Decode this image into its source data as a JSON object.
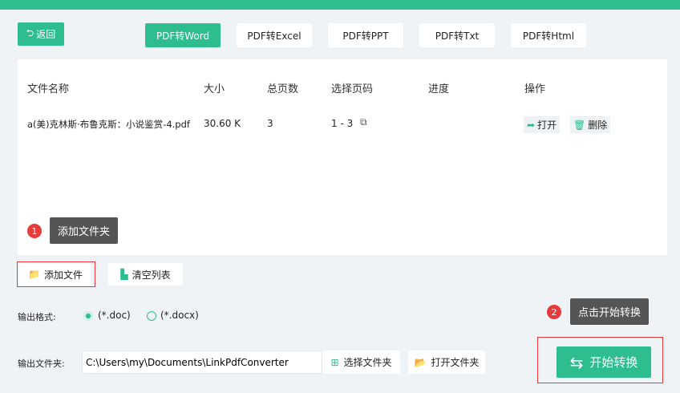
{
  "toolbar": {
    "back": "返回",
    "tabs": [
      "PDF转Word",
      "PDF转Excel",
      "PDF转PPT",
      "PDF转Txt",
      "PDF转Html"
    ]
  },
  "table": {
    "headers": [
      "文件名称",
      "大小",
      "总页数",
      "选择页码",
      "进度",
      "操作"
    ],
    "rows": [
      {
        "name": "a(美)克林斯·布鲁克斯：小说鉴赏-4.pdf",
        "size": "30.60 K",
        "pages": "3",
        "range": "1 - 3",
        "progress": "",
        "open": "打开",
        "delete": "删除"
      }
    ]
  },
  "tips": {
    "one_num": "1",
    "one": "添加文件夹",
    "two_num": "2",
    "two": "点击开始转换"
  },
  "actions": {
    "add_file": "添加文件",
    "clear_list": "清空列表"
  },
  "format": {
    "label": "输出格式:",
    "options": [
      "(*.doc)",
      "(*.docx)"
    ],
    "selected": "(*.doc)"
  },
  "output": {
    "label": "输出文件夹:",
    "path": "C:\\Users\\my\\Documents\\LinkPdfConverter",
    "choose": "选择文件夹",
    "open": "打开文件夹"
  },
  "start": "开始转换"
}
